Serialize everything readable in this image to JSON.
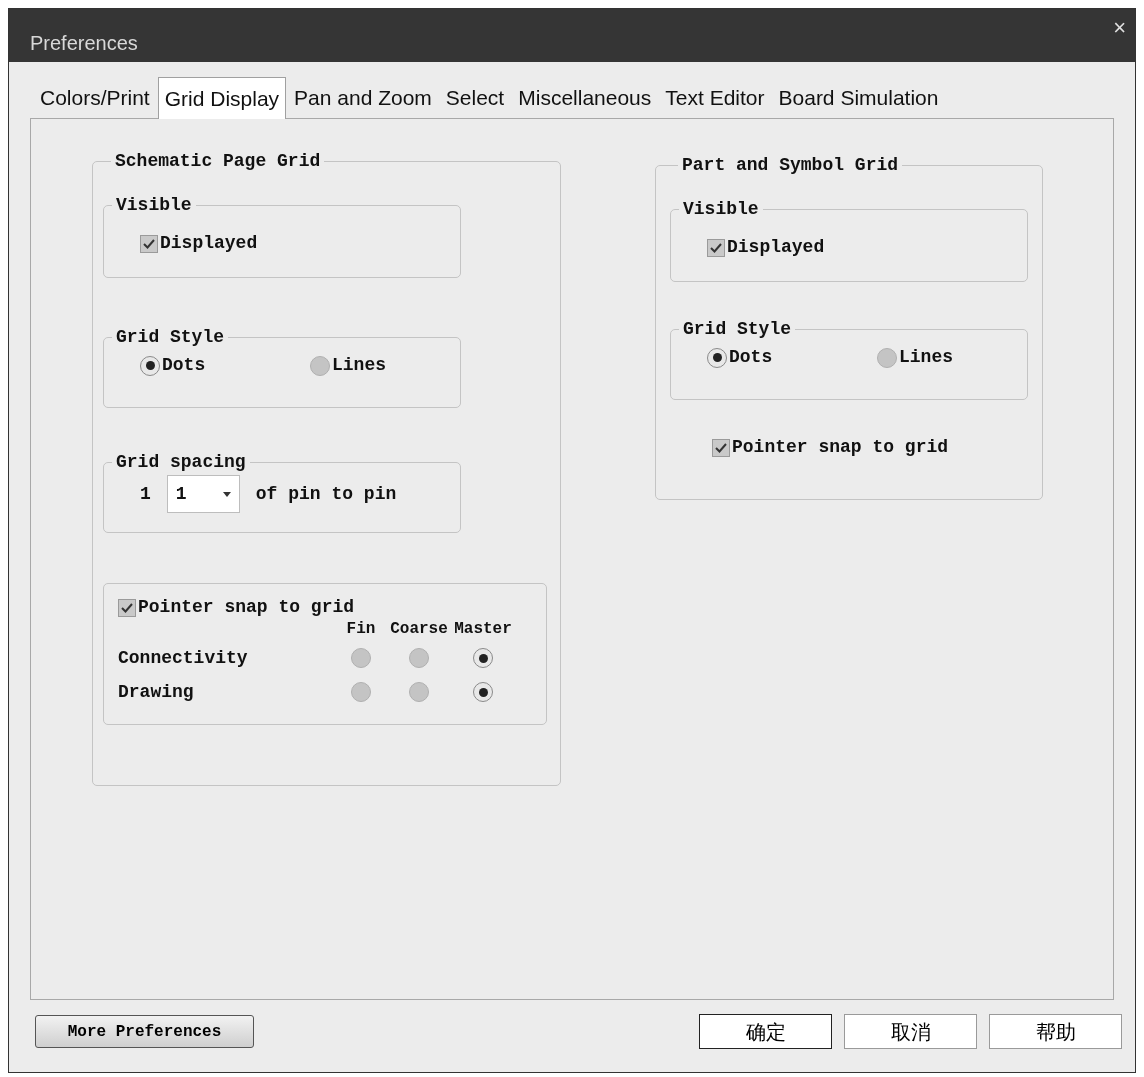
{
  "window": {
    "title": "Preferences",
    "close": "×"
  },
  "tabs": [
    {
      "label": "Colors/Print",
      "selected": false
    },
    {
      "label": "Grid Display",
      "selected": true
    },
    {
      "label": "Pan and Zoom",
      "selected": false
    },
    {
      "label": "Select",
      "selected": false
    },
    {
      "label": "Miscellaneous",
      "selected": false
    },
    {
      "label": "Text Editor",
      "selected": false
    },
    {
      "label": "Board Simulation",
      "selected": false
    }
  ],
  "groups": [
    {
      "title": "Schematic Page Grid",
      "visible": {
        "title": "Visible",
        "checkbox": {
          "label": "Displayed",
          "checked": true
        }
      },
      "grid_style": {
        "title": "Grid Style",
        "options": [
          {
            "label": "Dots",
            "selected": true
          },
          {
            "label": "Lines",
            "selected": false
          }
        ]
      },
      "grid_spacing": {
        "title": "Grid spacing",
        "label": "1",
        "value": "1",
        "suffix": "of pin to pin"
      },
      "snap_panel": {
        "checkbox": {
          "label": "Pointer snap to grid",
          "checked": true
        },
        "columns": [
          "Fin",
          "Coarse",
          "Master"
        ],
        "rows": [
          {
            "label": "Connectivity",
            "options": [
              {
                "selected": false
              },
              {
                "selected": false
              },
              {
                "selected": true
              }
            ]
          },
          {
            "label": "Drawing",
            "options": [
              {
                "selected": false
              },
              {
                "selected": false
              },
              {
                "selected": true
              }
            ]
          }
        ]
      }
    },
    {
      "title": "Part and Symbol Grid",
      "visible": {
        "title": "Visible",
        "checkbox": {
          "label": "Displayed",
          "checked": true
        }
      },
      "grid_style": {
        "title": "Grid Style",
        "options": [
          {
            "label": "Dots",
            "selected": true
          },
          {
            "label": "Lines",
            "selected": false
          }
        ]
      },
      "snap_checkbox": {
        "label": "Pointer snap to grid",
        "checked": true
      }
    }
  ],
  "footer": {
    "more_button": "More Preferences",
    "buttons": [
      {
        "label": "确定",
        "default": true
      },
      {
        "label": "取消",
        "default": false
      },
      {
        "label": "帮助",
        "default": false
      }
    ]
  }
}
